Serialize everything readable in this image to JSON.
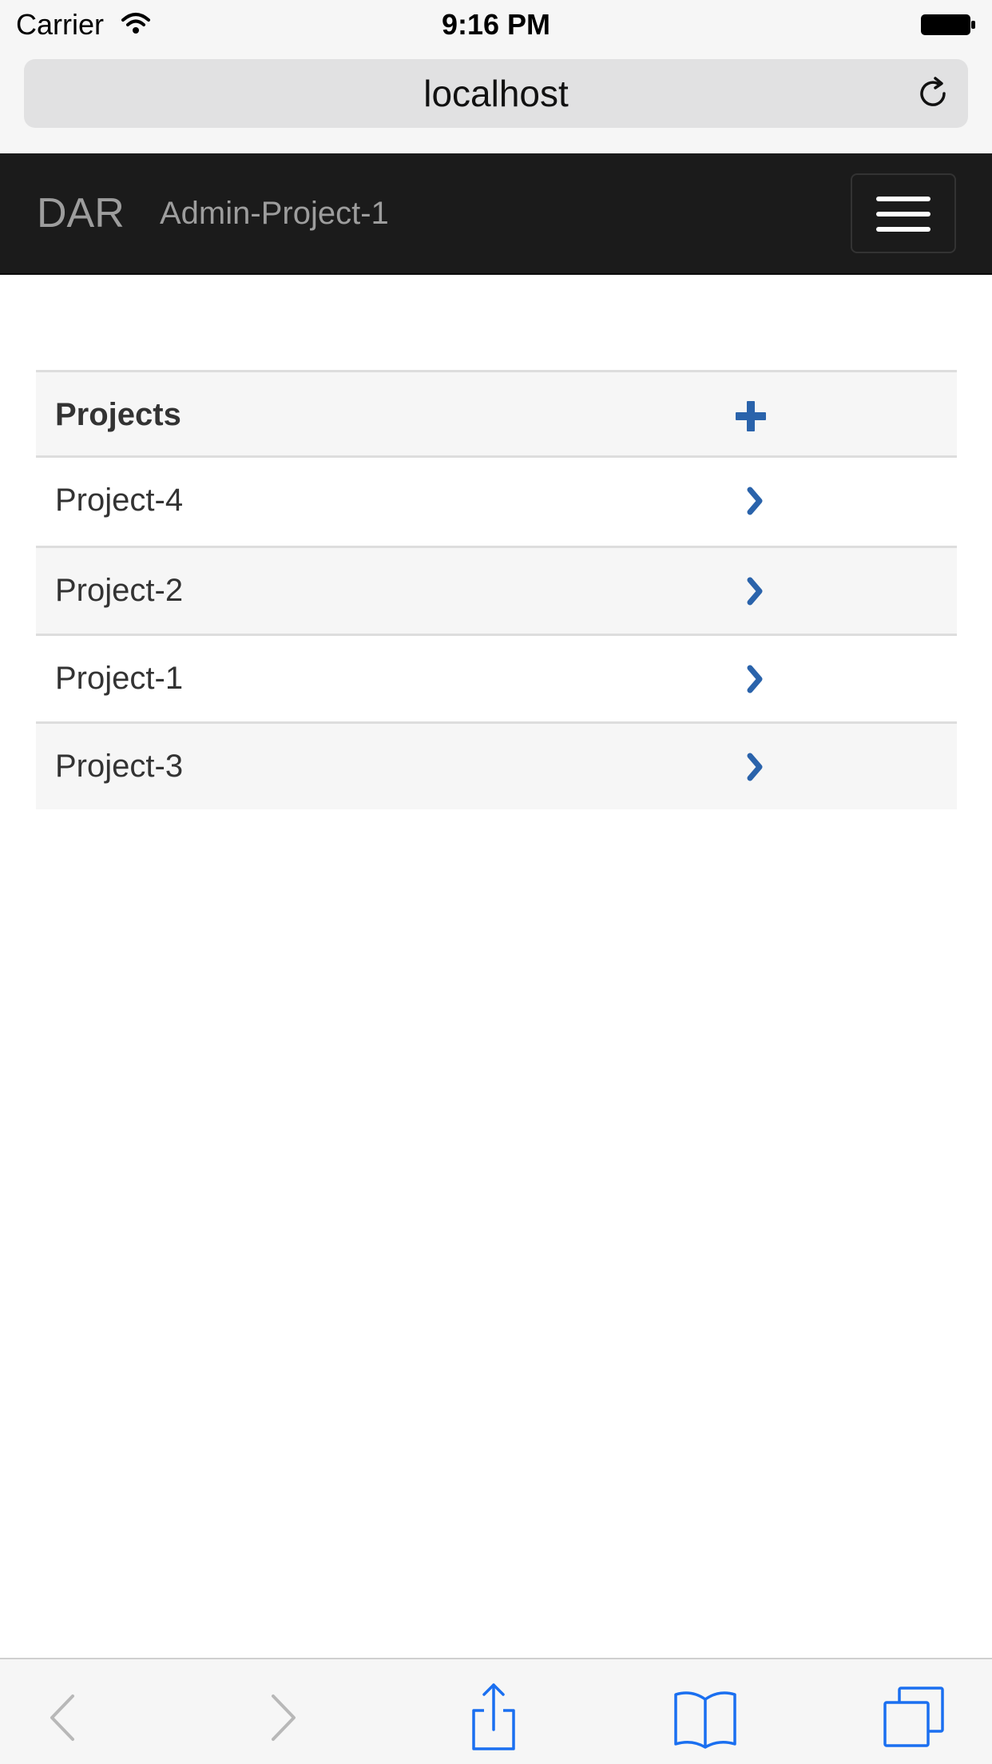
{
  "status_bar": {
    "carrier": "Carrier",
    "time": "9:16 PM",
    "icons": [
      "wifi-icon",
      "battery-icon"
    ]
  },
  "browser": {
    "url": "localhost",
    "reload_icon": "reload-icon"
  },
  "navbar": {
    "brand": "DAR",
    "current_project": "Admin-Project-1",
    "menu_icon": "hamburger-menu-icon",
    "background": "#1b1b1b",
    "text_color": "#9d9d9d"
  },
  "table": {
    "header_label": "Projects",
    "add_icon": "plus-icon",
    "rows": [
      {
        "label": "Project-4",
        "icon": "chevron-right-icon"
      },
      {
        "label": "Project-2",
        "icon": "chevron-right-icon"
      },
      {
        "label": "Project-1",
        "icon": "chevron-right-icon"
      },
      {
        "label": "Project-3",
        "icon": "chevron-right-icon"
      }
    ],
    "accent_color": "#2a63ab"
  },
  "toolbar": {
    "icons": [
      "back-icon",
      "forward-icon",
      "share-icon",
      "bookmarks-icon",
      "tabs-icon"
    ],
    "accent_color": "#1a6ff0"
  }
}
